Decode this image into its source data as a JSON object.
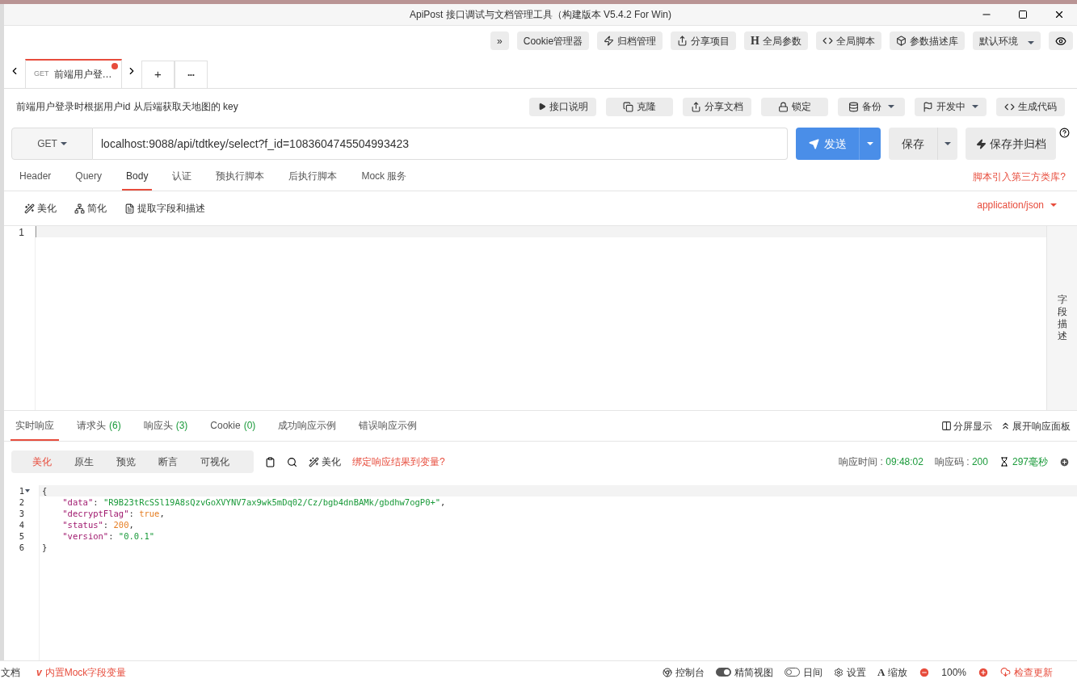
{
  "window": {
    "title": "ApiPost 接口调试与文档管理工具（构建版本 V5.4.2 For Win)"
  },
  "top_toolbar": [
    {
      "kind": "expand",
      "label": "»"
    },
    {
      "kind": "text",
      "label": "Cookie管理器"
    },
    {
      "kind": "bolt",
      "label": "归档管理"
    },
    {
      "kind": "share",
      "label": "分享项目"
    },
    {
      "kind": "h",
      "glyph": "H",
      "label": "全局参数"
    },
    {
      "kind": "code",
      "label": "全局脚本"
    },
    {
      "kind": "cube",
      "label": "参数描述库"
    },
    {
      "kind": "dropdown",
      "label": "默认环境"
    },
    {
      "kind": "eye"
    }
  ],
  "tabs": [
    {
      "method": "GET",
      "label": "前端用户登…",
      "selected": true,
      "unsaved": true
    }
  ],
  "tab_actions": [
    {
      "kind": "plus",
      "label": "+"
    },
    {
      "kind": "more",
      "label": "•••"
    }
  ],
  "description": "前端用户登录时根据用户id 从后端获取天地图的 key",
  "doc_actions": [
    {
      "kind": "play",
      "label": "接口说明",
      "dropdown": false
    },
    {
      "kind": "copy",
      "label": "克隆",
      "dropdown": false
    },
    {
      "kind": "share",
      "label": "分享文档",
      "dropdown": false
    },
    {
      "kind": "lock",
      "label": "锁定",
      "dropdown": false
    },
    {
      "kind": "db",
      "label": "备份",
      "dropdown": true
    },
    {
      "kind": "flag",
      "label": "开发中",
      "dropdown": true
    },
    {
      "kind": "code",
      "label": "生成代码",
      "dropdown": false
    }
  ],
  "request": {
    "method": "GET",
    "url": "localhost:9088/api/tdtkey/select?f_id=1083604745504993423",
    "send": "发送",
    "save": "保存",
    "save_archive": "保存并归档"
  },
  "request_tabs": [
    {
      "label": "Header",
      "selected": false
    },
    {
      "label": "Query",
      "selected": false
    },
    {
      "label": "Body",
      "selected": true
    },
    {
      "label": "认证",
      "selected": false
    },
    {
      "label": "预执行脚本",
      "selected": false
    },
    {
      "label": "后执行脚本",
      "selected": false
    },
    {
      "label": "Mock 服务",
      "selected": false
    }
  ],
  "script_link": "脚本引入第三方类库?",
  "body_tools": [
    {
      "kind": "wand",
      "label": "美化"
    },
    {
      "kind": "sitemap",
      "label": "简化"
    },
    {
      "kind": "file",
      "label": "提取字段和描述"
    }
  ],
  "content_type": "application/json",
  "body_editor": {
    "line_numbers": [
      "1"
    ]
  },
  "field_panel": "字段描述",
  "response_tabs": [
    {
      "label": "实时响应",
      "selected": true
    },
    {
      "label": "请求头",
      "count": "(6)",
      "selected": false
    },
    {
      "label": "响应头",
      "count": "(3)",
      "selected": false
    },
    {
      "label": "Cookie",
      "count": "(0)",
      "selected": false
    },
    {
      "label": "成功响应示例",
      "selected": false
    },
    {
      "label": "错误响应示例",
      "selected": false
    }
  ],
  "response_actions": [
    {
      "kind": "split",
      "label": "分屏显示"
    },
    {
      "kind": "expand",
      "label": "展开响应面板"
    }
  ],
  "view_modes": [
    {
      "label": "美化",
      "selected": true
    },
    {
      "label": "原生",
      "selected": false
    },
    {
      "label": "预览",
      "selected": false
    },
    {
      "label": "断言",
      "selected": false
    },
    {
      "label": "可视化",
      "selected": false
    }
  ],
  "response_tools": [
    {
      "kind": "copy"
    },
    {
      "kind": "search"
    },
    {
      "kind": "wand",
      "label": "美化"
    }
  ],
  "bind_link": "绑定响应结果到变量?",
  "response_meta": {
    "time_label": "响应时间 : ",
    "time": "09:48:02",
    "code_label": "响应码 : ",
    "code": "200",
    "duration": "297毫秒"
  },
  "response_code": [
    {
      "number": "1",
      "fold": true,
      "tokens": [
        {
          "kind": "punct",
          "text": "{"
        }
      ]
    },
    {
      "number": "2",
      "fold": false,
      "tokens": [
        {
          "kind": "key",
          "text": "    \"data\""
        },
        {
          "kind": "punct",
          "text": ": "
        },
        {
          "kind": "string",
          "text": "\"R9B23tRcSSl19A8sQzvGoXVYNV7ax9wk5mDq02/Cz/bgb4dnBAMk/gbdhw7ogP0+\""
        },
        {
          "kind": "punct",
          "text": ","
        }
      ]
    },
    {
      "number": "3",
      "fold": false,
      "tokens": [
        {
          "kind": "key",
          "text": "    \"decryptFlag\""
        },
        {
          "kind": "punct",
          "text": ": "
        },
        {
          "kind": "literal",
          "text": "true"
        },
        {
          "kind": "punct",
          "text": ","
        }
      ]
    },
    {
      "number": "4",
      "fold": false,
      "tokens": [
        {
          "kind": "key",
          "text": "    \"status\""
        },
        {
          "kind": "punct",
          "text": ": "
        },
        {
          "kind": "literal",
          "text": "200"
        },
        {
          "kind": "punct",
          "text": ","
        }
      ]
    },
    {
      "number": "5",
      "fold": false,
      "tokens": [
        {
          "kind": "key",
          "text": "    \"version\""
        },
        {
          "kind": "punct",
          "text": ": "
        },
        {
          "kind": "string",
          "text": "\"0.0.1\""
        }
      ]
    },
    {
      "number": "6",
      "fold": false,
      "tokens": [
        {
          "kind": "punct",
          "text": "}"
        }
      ]
    }
  ],
  "status_bar": {
    "left": [
      {
        "kind": "text",
        "label": "文档"
      },
      {
        "kind": "mock",
        "glyph": "v",
        "label": "内置Mock字段变量"
      }
    ],
    "right": [
      {
        "kind": "chrome",
        "label": "控制台"
      },
      {
        "kind": "toggle",
        "label": "精简视图",
        "on": true
      },
      {
        "kind": "toggle",
        "label": "日间",
        "on": false
      },
      {
        "kind": "gear",
        "label": "设置"
      },
      {
        "kind": "font",
        "glyph": "A",
        "label": "缩放"
      },
      {
        "kind": "minus"
      },
      {
        "kind": "text",
        "label": "100%"
      },
      {
        "kind": "plus"
      },
      {
        "kind": "cloud",
        "label": "检查更新"
      }
    ]
  }
}
